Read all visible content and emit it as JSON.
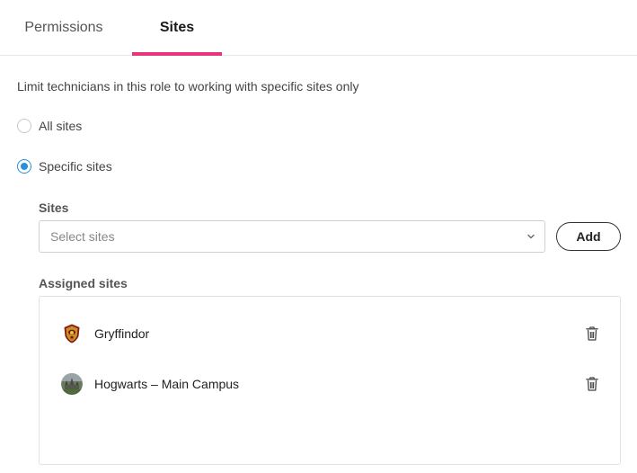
{
  "tabs": [
    {
      "label": "Permissions",
      "active": false
    },
    {
      "label": "Sites",
      "active": true
    }
  ],
  "accent_color": "#e6357e",
  "radio_color": "#2a8fdd",
  "intro_text": "Limit technicians in this role to working with specific sites only",
  "scope_options": [
    {
      "label": "All sites",
      "selected": false
    },
    {
      "label": "Specific sites",
      "selected": true
    }
  ],
  "sites_field": {
    "label": "Sites",
    "placeholder": "Select sites",
    "add_label": "Add"
  },
  "assigned": {
    "label": "Assigned sites",
    "items": [
      {
        "name": "Gryffindor",
        "icon": "gryffindor-crest-icon"
      },
      {
        "name": "Hogwarts – Main Campus",
        "icon": "hogwarts-photo-icon"
      }
    ]
  }
}
